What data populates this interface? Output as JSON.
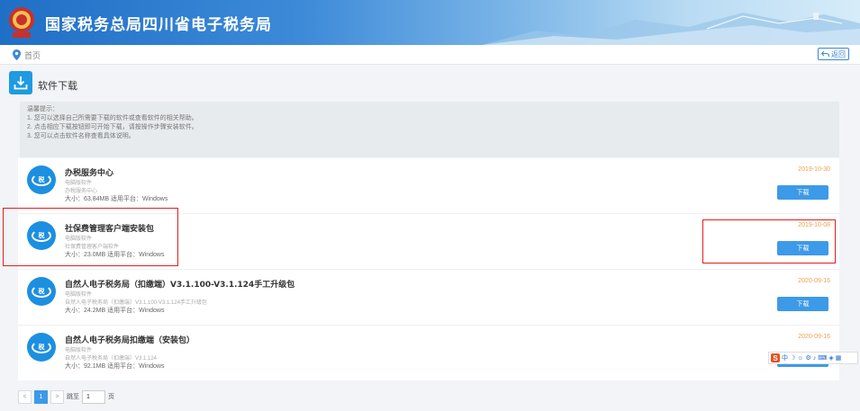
{
  "header": {
    "title": "国家税务总局四川省电子税务局"
  },
  "breadcrumb": {
    "current": "首页",
    "back_label": "返回"
  },
  "section": {
    "title": "软件下载"
  },
  "tips": [
    "温馨提示：",
    "1. 您可以选择自己所需要下载的软件或查看软件的相关帮助。",
    "2. 点击相应下载按钮即可开始下载，请按操作步骤安装软件。",
    "3. 您可以点击软件名称查看具体说明。"
  ],
  "items": [
    {
      "name": "办税服务中心",
      "line1": "电脑版软件",
      "line2": "办税服务中心",
      "meta": "大小：63.84MB 适用平台：Windows",
      "date": "2019-10-30",
      "button": "下载"
    },
    {
      "name": "社保费管理客户端安装包",
      "line1": "电脑版软件",
      "line2": "社保费管理客户端软件",
      "meta": "大小：23.0MB 适用平台：Windows",
      "date": "2019-10-08",
      "button": "下载"
    },
    {
      "name": "自然人电子税务局（扣缴端）V3.1.100-V3.1.124手工升级包",
      "line1": "电脑版软件",
      "line2": "自然人电子税务局（扣缴端）V3.1.100-V3.1.124手工升级包",
      "meta": "大小：24.2MB 适用平台：Windows",
      "date": "2020-09-16",
      "button": "下载"
    },
    {
      "name": "自然人电子税务局扣缴端（安装包）",
      "line1": "电脑版软件",
      "line2": "自然人电子税务局（扣缴端）V3.1.124",
      "meta": "大小：92.1MB 适用平台：Windows",
      "date": "2020-09-16",
      "button": "下载"
    }
  ],
  "ime": {
    "label": "中"
  },
  "pager": {
    "prev": "<",
    "current": "1",
    "next": ">",
    "goto_label": "跳至",
    "goto_value": "1",
    "page_suffix": "页"
  }
}
